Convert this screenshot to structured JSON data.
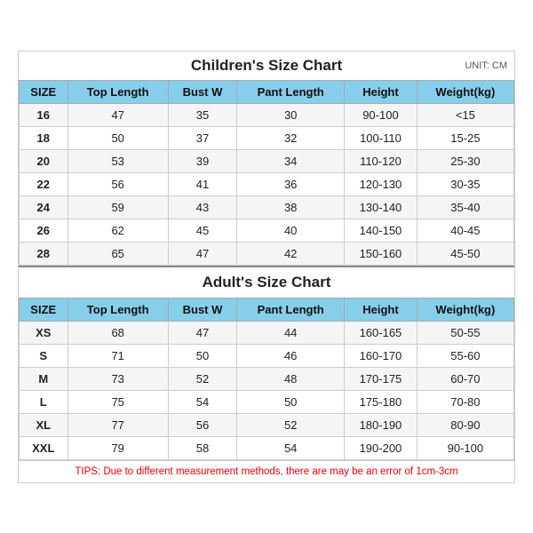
{
  "children_chart": {
    "title": "Children's Size Chart",
    "unit": "UNIT: CM",
    "headers": [
      "SIZE",
      "Top Length",
      "Bust W",
      "Pant Length",
      "Height",
      "Weight(kg)"
    ],
    "rows": [
      [
        "16",
        "47",
        "35",
        "30",
        "90-100",
        "<15"
      ],
      [
        "18",
        "50",
        "37",
        "32",
        "100-110",
        "15-25"
      ],
      [
        "20",
        "53",
        "39",
        "34",
        "110-120",
        "25-30"
      ],
      [
        "22",
        "56",
        "41",
        "36",
        "120-130",
        "30-35"
      ],
      [
        "24",
        "59",
        "43",
        "38",
        "130-140",
        "35-40"
      ],
      [
        "26",
        "62",
        "45",
        "40",
        "140-150",
        "40-45"
      ],
      [
        "28",
        "65",
        "47",
        "42",
        "150-160",
        "45-50"
      ]
    ]
  },
  "adult_chart": {
    "title": "Adult's Size Chart",
    "headers": [
      "SIZE",
      "Top Length",
      "Bust W",
      "Pant Length",
      "Height",
      "Weight(kg)"
    ],
    "rows": [
      [
        "XS",
        "68",
        "47",
        "44",
        "160-165",
        "50-55"
      ],
      [
        "S",
        "71",
        "50",
        "46",
        "160-170",
        "55-60"
      ],
      [
        "M",
        "73",
        "52",
        "48",
        "170-175",
        "60-70"
      ],
      [
        "L",
        "75",
        "54",
        "50",
        "175-180",
        "70-80"
      ],
      [
        "XL",
        "77",
        "56",
        "52",
        "180-190",
        "80-90"
      ],
      [
        "XXL",
        "79",
        "58",
        "54",
        "190-200",
        "90-100"
      ]
    ]
  },
  "tips": "TIPS: Due to different measurement methods, there are may be an error of 1cm-3cm"
}
